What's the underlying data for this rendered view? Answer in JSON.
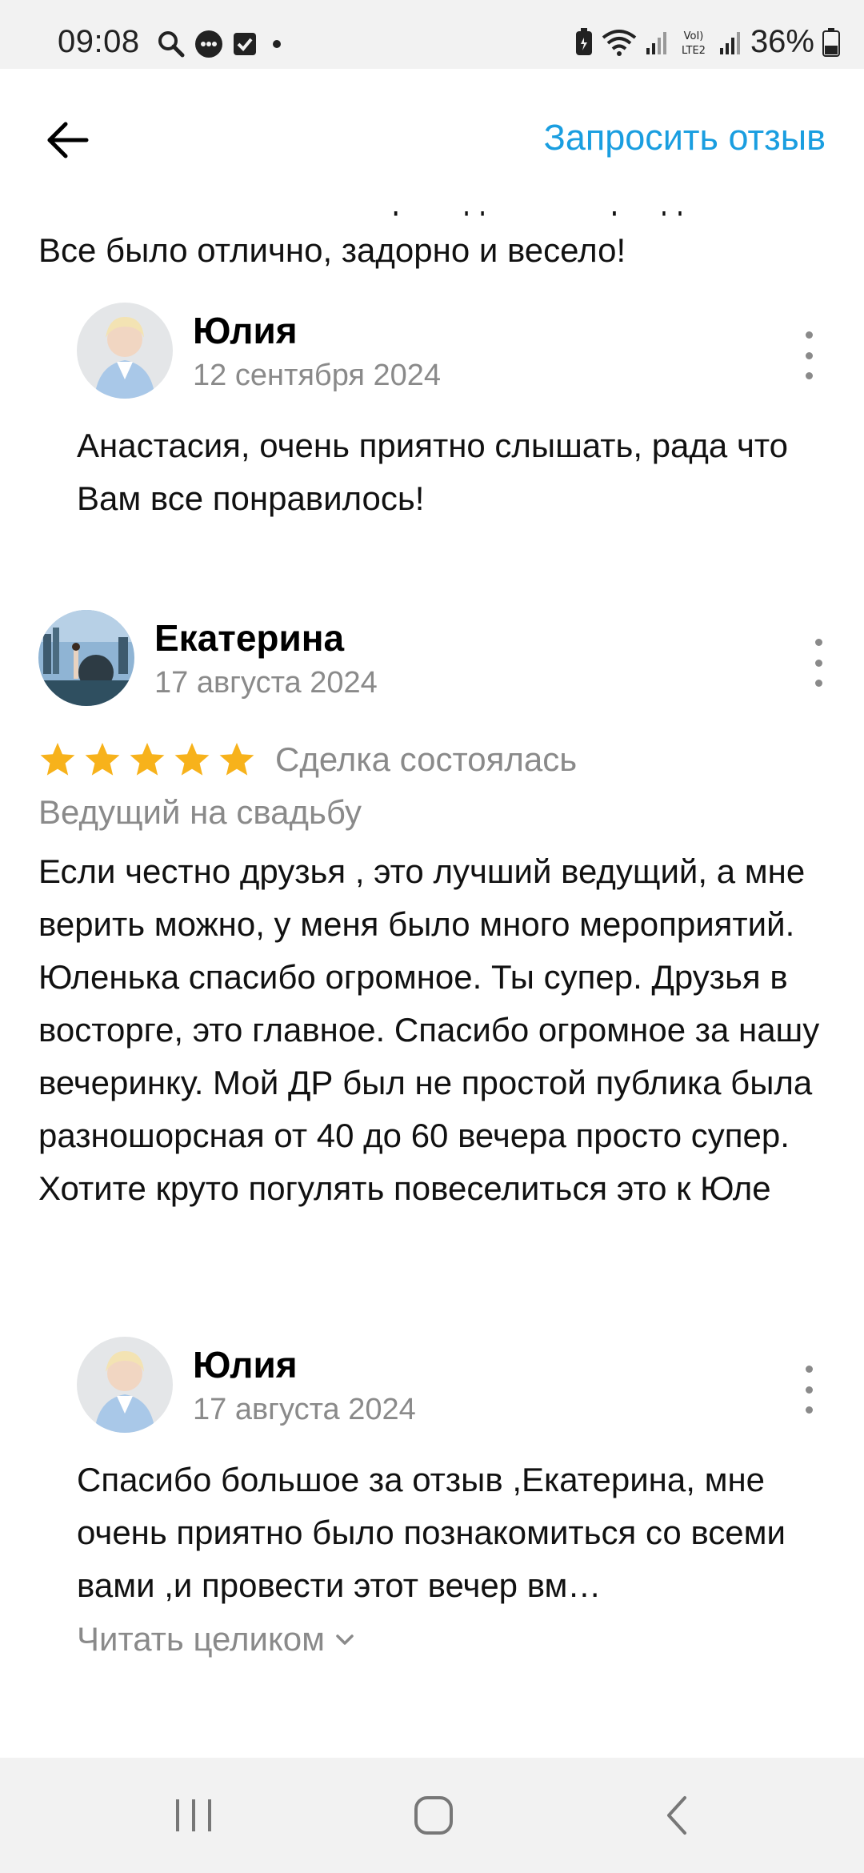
{
  "status_bar": {
    "time": "09:08",
    "battery": "36%",
    "icons_left": [
      "search-icon",
      "chat-bubble-icon",
      "checkbox-icon",
      "dot-icon"
    ],
    "icons_right": [
      "battery-saver-icon",
      "wifi-icon",
      "signal-icon",
      "volte-icon",
      "signal-icon",
      "battery-icon"
    ]
  },
  "header": {
    "back_icon": "arrow-left-icon",
    "request_review": "Запросить отзыв"
  },
  "partial_review": {
    "clipped_line": "Спасибо большое за проведенный праздник!",
    "text": "Все было отлично, задорно и весело!"
  },
  "reply_1": {
    "name": "Юлия",
    "date": "12 сентября 2024",
    "text": "Анастасия, очень приятно слышать,  рада что Вам все понравилось!"
  },
  "review_2": {
    "name": "Екатерина",
    "date": "17 августа 2024",
    "rating": 5,
    "deal_status": "Сделка состоялась",
    "category": "Ведущий на свадьбу",
    "text": "Если честно друзья , это лучший ведущий, а мне верить можно, у меня было много мероприятий. Юленька спасибо огромное. Ты супер. Друзья в восторге, это главное. Спасибо огромное за нашу вечеринку. Мой ДР был не простой публика была разношорсная от 40 до 60 вечера просто супер. Хотите круто погулять повеселиться это к Юле"
  },
  "reply_2": {
    "name": "Юлия",
    "date": "17 августа 2024",
    "text": "Спасибо большое за отзыв ,Екатерина, мне очень приятно было познакомиться со всеми вами ,и провести этот вечер вм…",
    "read_more": "Читать целиком"
  },
  "colors": {
    "accent": "#1a9ee0",
    "star": "#f7b21b",
    "muted": "#8a8a8a"
  }
}
